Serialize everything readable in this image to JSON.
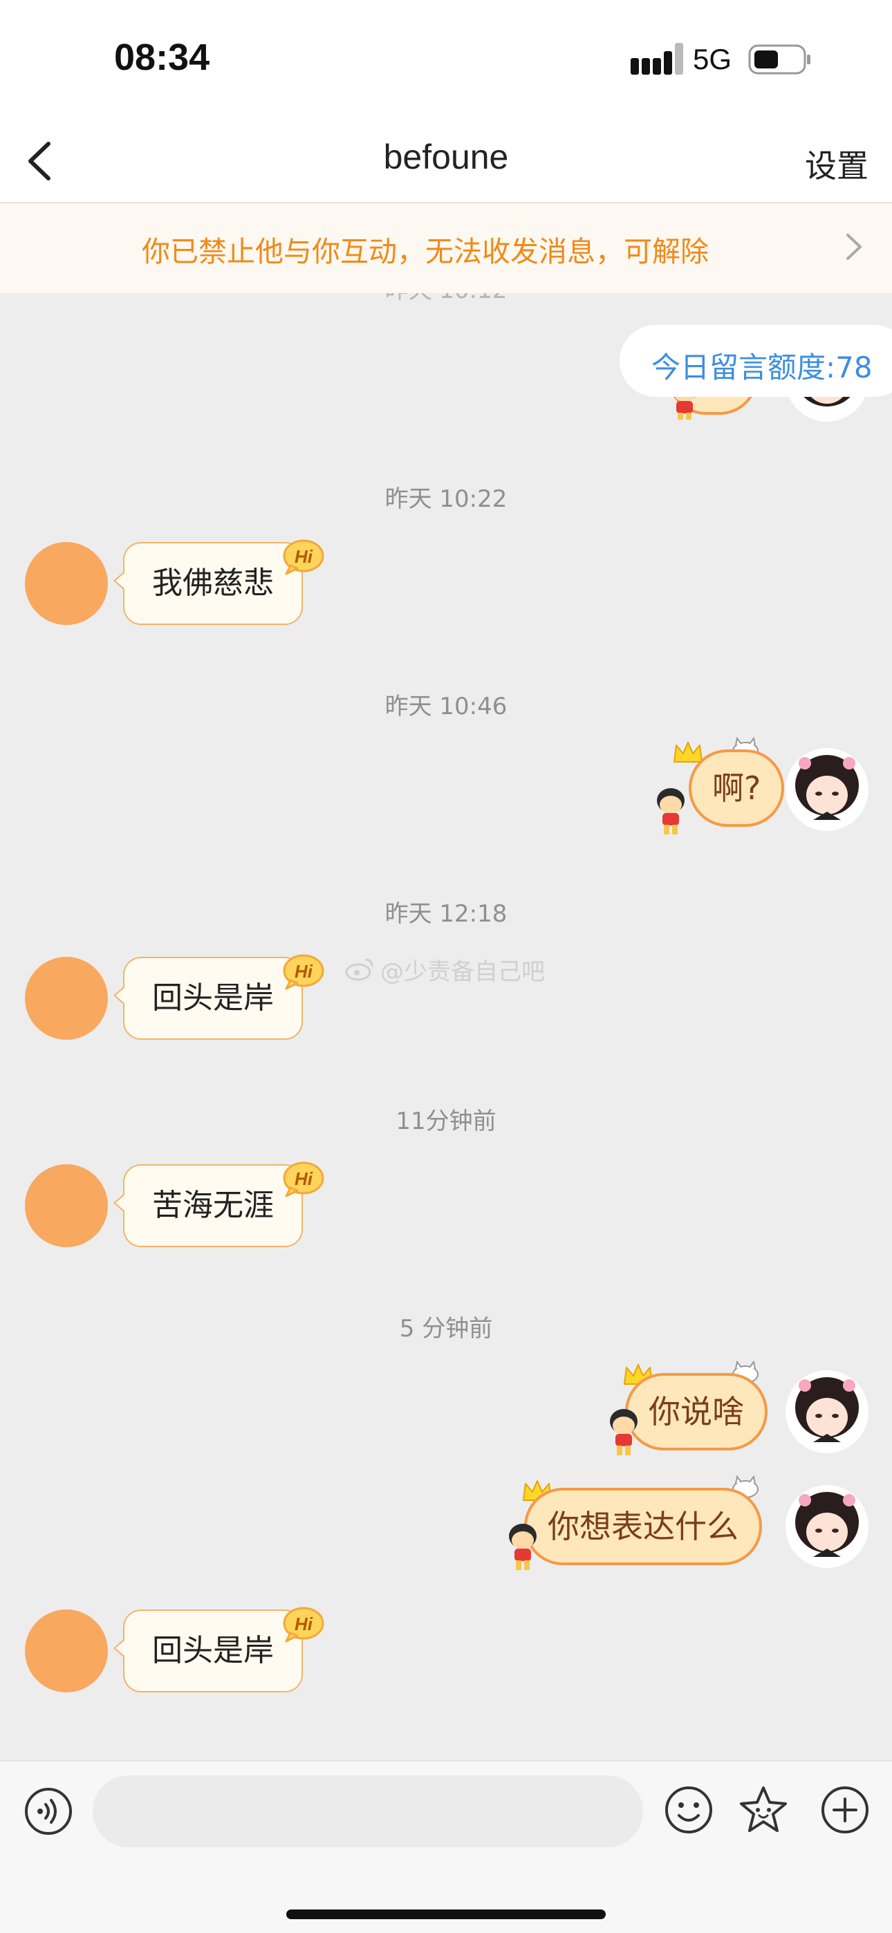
{
  "status_bar": {
    "time": "08:34",
    "network": "5G"
  },
  "nav": {
    "title": "befoune",
    "settings_label": "设置"
  },
  "banner": {
    "text": "你已禁止他与你互动，无法收发消息，可解除"
  },
  "quota": {
    "text": "今日留言额度:78"
  },
  "watermark": {
    "text": "@少责备自己吧"
  },
  "timestamps": {
    "partial": "昨天 10:12",
    "t1": "昨天 10:22",
    "t2": "昨天 10:46",
    "t3": "昨天 12:18",
    "t4": "11分钟前",
    "t5": "5 分钟前"
  },
  "messages": {
    "in1": "我佛慈悲",
    "out1": "啊?",
    "in2": "回头是岸",
    "in3": "苦海无涯",
    "out2": "你说啥",
    "out3": "你想表达什么",
    "in4": "回头是岸"
  },
  "badge": {
    "hi": "Hi"
  },
  "input": {
    "placeholder": ""
  },
  "colors": {
    "banner_text": "#f08a1a",
    "quota_text": "#3d8ee0",
    "avatar_orange": "#f9a860",
    "bubble_out_border": "#f49a47"
  },
  "icons": [
    "back-icon",
    "chevron-right-icon",
    "signal-icon",
    "battery-icon",
    "hi-badge-icon",
    "crown-icon",
    "cartoon-kid-icon",
    "cat-icon",
    "weibo-icon",
    "voice-icon",
    "emoji-icon",
    "sticker-icon",
    "plus-icon"
  ]
}
